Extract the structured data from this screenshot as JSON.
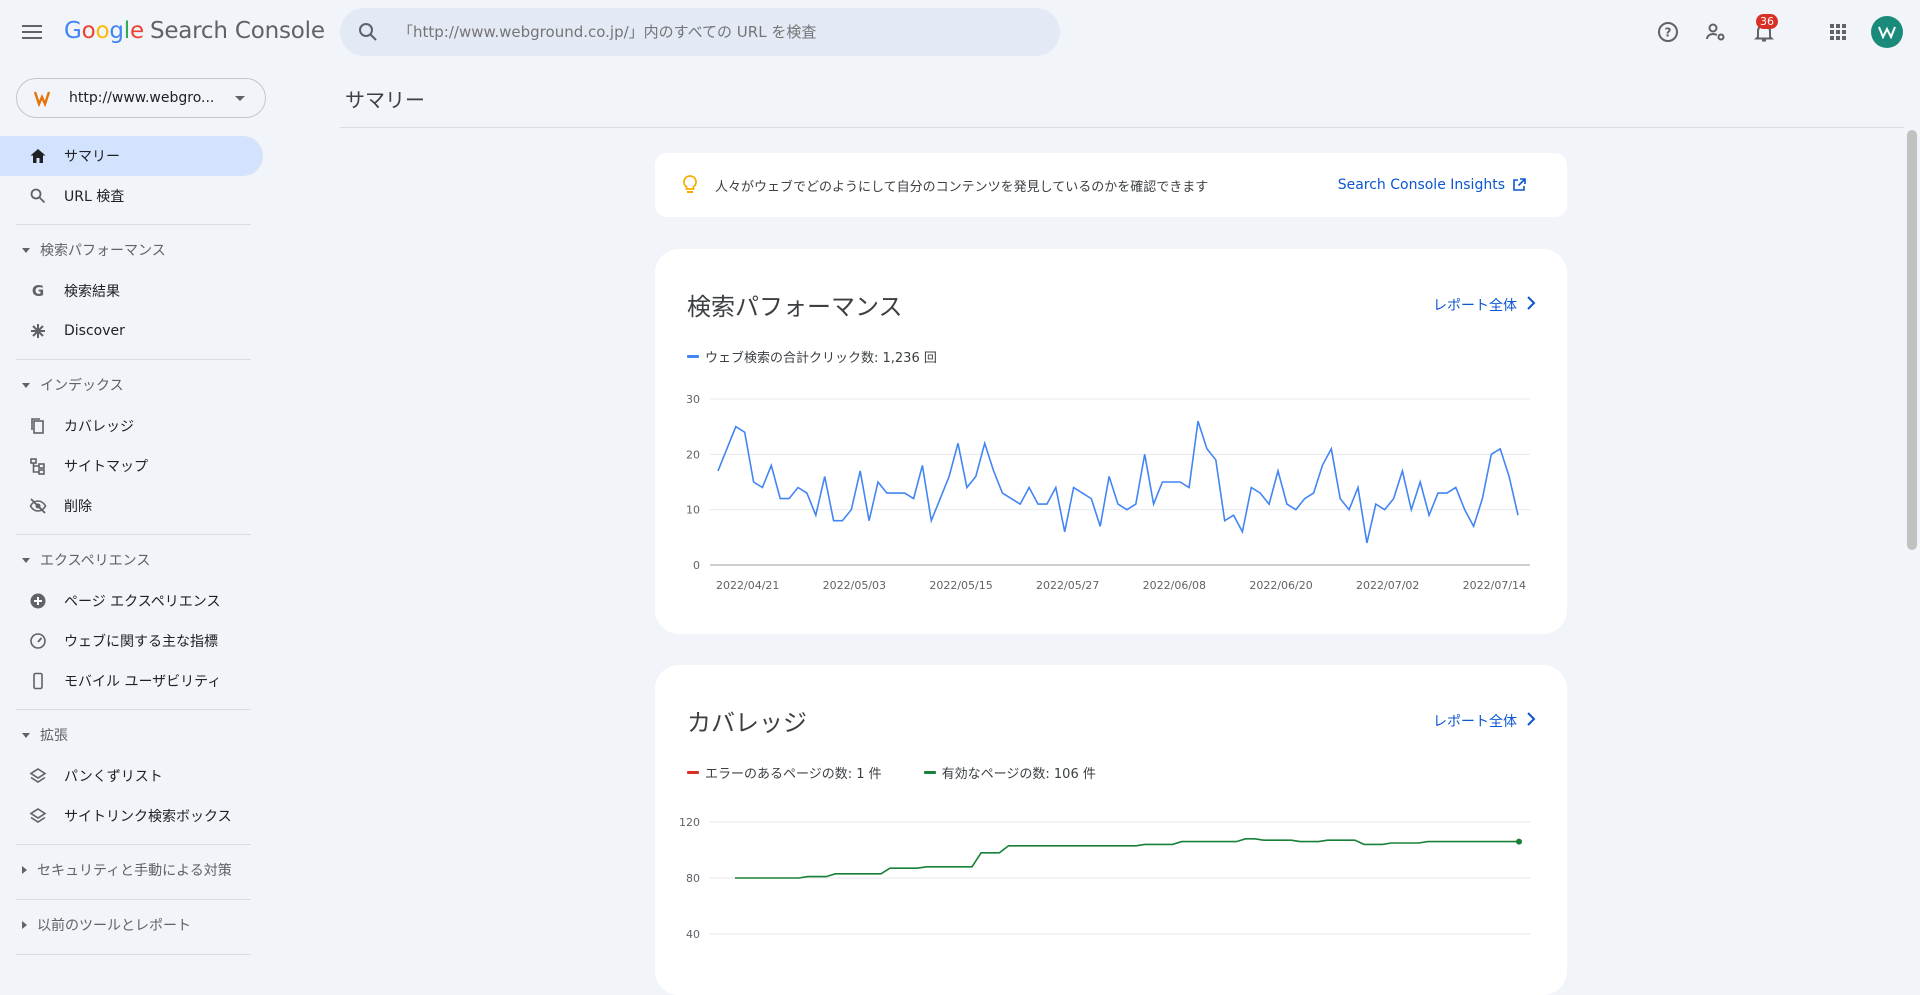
{
  "app": {
    "logo_google": [
      "G",
      "o",
      "o",
      "g",
      "l",
      "e"
    ],
    "logo_product": "Search Console",
    "search_placeholder": "「http://www.webground.co.jp/」内のすべての URL を検査",
    "notification_count": "36"
  },
  "property": {
    "label": "http://www.webgro..."
  },
  "sidebar": {
    "items_top": [
      {
        "label": "サマリー",
        "icon": "home-icon",
        "active": true
      },
      {
        "label": "URL 検査",
        "icon": "search-icon",
        "active": false
      }
    ],
    "sections": [
      {
        "label": "検索パフォーマンス",
        "items": [
          {
            "label": "検索結果",
            "icon": "google-g-icon"
          },
          {
            "label": "Discover",
            "icon": "asterisk-icon"
          }
        ]
      },
      {
        "label": "インデックス",
        "items": [
          {
            "label": "カバレッジ",
            "icon": "copy-icon"
          },
          {
            "label": "サイトマップ",
            "icon": "sitemap-icon"
          },
          {
            "label": "削除",
            "icon": "eye-off-icon"
          }
        ]
      },
      {
        "label": "エクスペリエンス",
        "items": [
          {
            "label": "ページ エクスペリエンス",
            "icon": "plus-circle-icon"
          },
          {
            "label": "ウェブに関する主な指標",
            "icon": "speedometer-icon"
          },
          {
            "label": "モバイル ユーザビリティ",
            "icon": "phone-icon"
          }
        ]
      },
      {
        "label": "拡張",
        "items": [
          {
            "label": "パンくずリスト",
            "icon": "layers-icon"
          },
          {
            "label": "サイトリンク検索ボックス",
            "icon": "layers-icon"
          }
        ]
      }
    ],
    "collapsed": [
      "セキュリティと手動による対策",
      "以前のツールとレポート"
    ]
  },
  "main": {
    "title": "サマリー",
    "insight": {
      "text": "人々がウェブでどのようにして自分のコンテンツを発見しているのかを確認できます",
      "link": "Search Console Insights"
    },
    "performance": {
      "title": "検索パフォーマンス",
      "report_link": "レポート全体",
      "legend": "ウェブ検索の合計クリック数: 1,236 回"
    },
    "coverage": {
      "title": "カバレッジ",
      "report_link": "レポート全体",
      "legend_error": "エラーのあるページの数: 1 件",
      "legend_valid": "有効なページの数: 106 件"
    }
  },
  "colors": {
    "accent": "#4285f4",
    "valid": "#188038",
    "error": "#d93025",
    "link": "#0b57d0"
  },
  "chart_data": [
    {
      "type": "line",
      "ylim": [
        0,
        30
      ],
      "yticks": [
        0,
        10,
        20,
        30
      ],
      "xticks": [
        "2022/04/21",
        "2022/05/03",
        "2022/05/15",
        "2022/05/27",
        "2022/06/08",
        "2022/06/20",
        "2022/07/02",
        "2022/07/14"
      ],
      "x_start": "2022/04/21",
      "series": [
        {
          "name": "ウェブ検索の合計クリック数",
          "color": "#4285f4",
          "values": [
            17,
            21,
            25,
            24,
            15,
            14,
            18,
            12,
            12,
            14,
            13,
            9,
            16,
            8,
            8,
            10,
            17,
            8,
            15,
            13,
            13,
            13,
            12,
            18,
            8,
            12,
            16,
            22,
            14,
            16,
            22,
            17,
            13,
            12,
            11,
            14,
            11,
            11,
            14,
            6,
            14,
            13,
            12,
            7,
            16,
            11,
            10,
            11,
            20,
            11,
            15,
            15,
            15,
            14,
            26,
            21,
            19,
            8,
            9,
            6,
            14,
            13,
            11,
            17,
            11,
            10,
            12,
            13,
            18,
            21,
            12,
            10,
            14,
            4,
            11,
            10,
            12,
            17,
            10,
            15,
            9,
            13,
            13,
            14,
            10,
            7,
            12,
            20,
            21,
            16,
            9
          ]
        }
      ]
    },
    {
      "type": "line",
      "ylim": [
        0,
        120
      ],
      "yticks": [
        40,
        80,
        120
      ],
      "series": [
        {
          "name": "有効なページの数",
          "color": "#188038",
          "values": [
            80,
            80,
            80,
            80,
            80,
            80,
            80,
            80,
            81,
            81,
            81,
            83,
            83,
            83,
            83,
            83,
            83,
            87,
            87,
            87,
            87,
            88,
            88,
            88,
            88,
            88,
            88,
            98,
            98,
            98,
            103,
            103,
            103,
            103,
            103,
            103,
            103,
            103,
            103,
            103,
            103,
            103,
            103,
            103,
            103,
            104,
            104,
            104,
            104,
            106,
            106,
            106,
            106,
            106,
            106,
            106,
            108,
            108,
            107,
            107,
            107,
            107,
            106,
            106,
            106,
            107,
            107,
            107,
            107,
            104,
            104,
            104,
            105,
            105,
            105,
            105,
            106,
            106,
            106,
            106,
            106,
            106,
            106,
            106,
            106,
            106,
            106
          ]
        },
        {
          "name": "エラーのあるページの数",
          "color": "#d93025",
          "values": []
        }
      ]
    }
  ]
}
